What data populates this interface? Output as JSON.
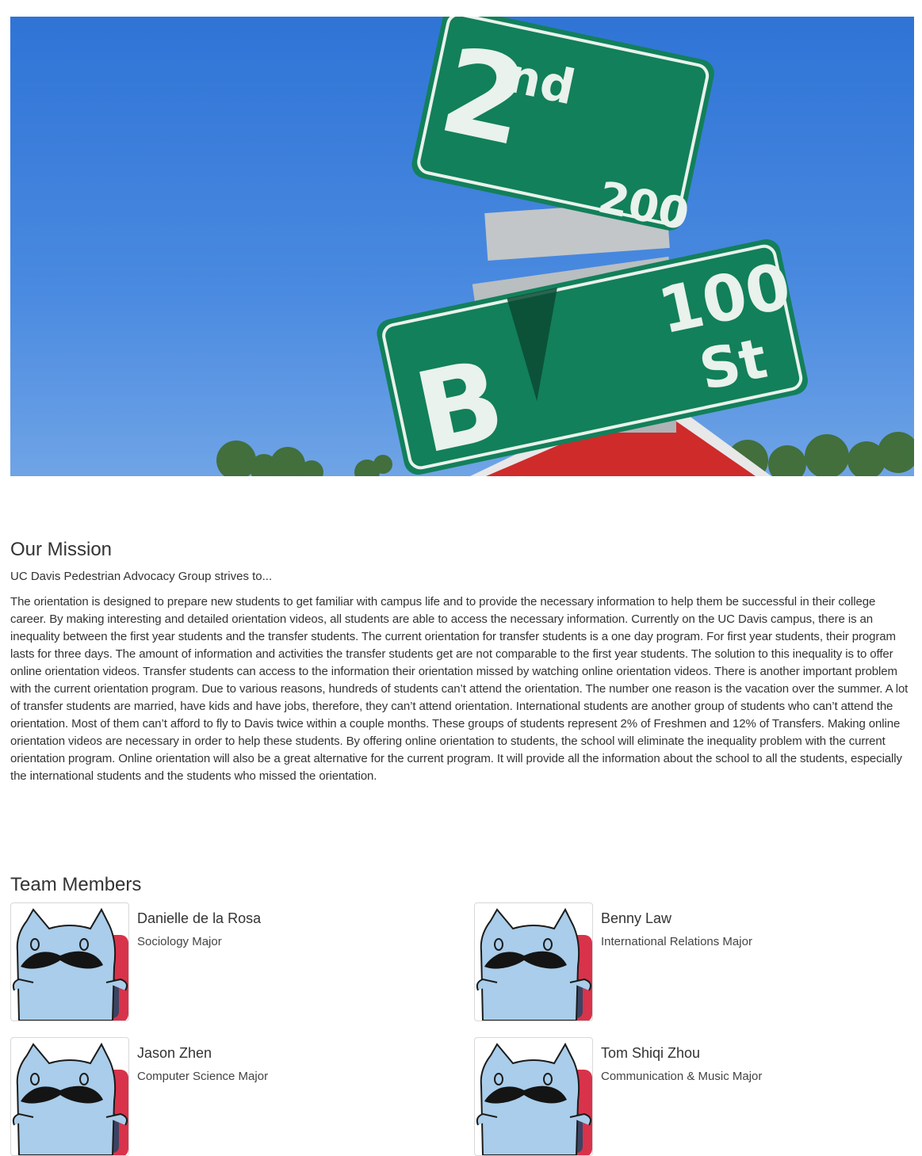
{
  "hero": {
    "sign_top_number": "2",
    "sign_top_suffix": "nd",
    "sign_top_block": "200",
    "sign_bottom_letter": "B",
    "sign_bottom_block": "100",
    "sign_bottom_suffix": "St"
  },
  "mission": {
    "title": "Our Mission",
    "lead": "UC Davis Pedestrian Advocacy Group strives to...",
    "body": "The orientation is designed to prepare new students to get familiar with campus life and to provide the necessary information to help them be successful in their college career. By making interesting and detailed orientation videos, all students are able to access the necessary information. Currently on the UC Davis campus, there is an inequality between the first year students and the transfer students. The current orientation for transfer students is a one day program. For first year students, their program lasts for three days. The amount of information and activities the transfer students get are not comparable to the first year students. The solution to this inequality is to offer online orientation videos. Transfer students can access to the information their orientation missed by watching online orientation videos. There is another important problem with the current orientation program. Due to various reasons, hundreds of students can’t attend the orientation. The number one reason is the vacation over the summer. A lot of transfer students are married, have kids and have jobs, therefore, they can’t attend orientation. International students are another group of students who can’t attend the orientation. Most of them can’t afford to fly to Davis twice within a couple months. These groups of students represent 2% of Freshmen and 12% of Transfers. Making online orientation videos are necessary in order to help these students. By offering online orientation to students, the school will eliminate the inequality problem with the current orientation program. Online orientation will also be a great alternative for the current program. It will provide all the information about the school to all the students, especially the international students and the students who missed the orientation."
  },
  "team": {
    "title": "Team Members",
    "members": [
      {
        "name": "Danielle de la Rosa",
        "major": "Sociology Major"
      },
      {
        "name": "Benny Law",
        "major": "International Relations Major"
      },
      {
        "name": "Jason Zhen",
        "major": "Computer Science Major"
      },
      {
        "name": "Tom Shiqi Zhou",
        "major": "Communication & Music Major"
      }
    ]
  },
  "colors": {
    "sky": "#3f7fd6",
    "sign_green": "#12805a",
    "stop_red": "#cf2b2b",
    "avatar_blue": "#a9cdea"
  },
  "icons": {
    "avatar": "mustache-cat-avatar"
  }
}
